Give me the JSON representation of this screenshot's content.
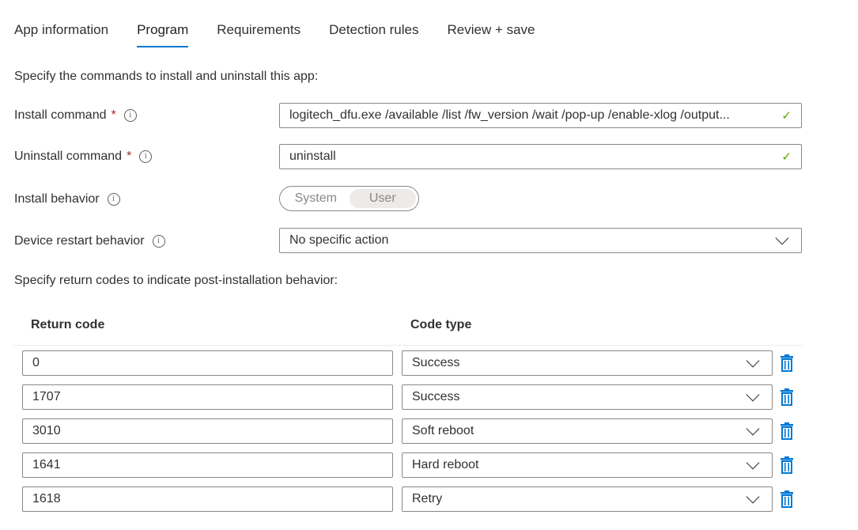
{
  "tabs": [
    {
      "label": "App information",
      "active": false
    },
    {
      "label": "Program",
      "active": true
    },
    {
      "label": "Requirements",
      "active": false
    },
    {
      "label": "Detection rules",
      "active": false
    },
    {
      "label": "Review + save",
      "active": false
    }
  ],
  "commands_intro": "Specify the commands to install and uninstall this app:",
  "install_command": {
    "label": "Install command",
    "required_mark": "*",
    "value": "logitech_dfu.exe /available /list /fw_version /wait /pop-up /enable-xlog /output..."
  },
  "uninstall_command": {
    "label": "Uninstall command",
    "required_mark": "*",
    "value": "uninstall"
  },
  "install_behavior": {
    "label": "Install behavior",
    "options": [
      "System",
      "User"
    ],
    "selected": "User"
  },
  "restart_behavior": {
    "label": "Device restart behavior",
    "value": "No specific action"
  },
  "return_codes_intro": "Specify return codes to indicate post-installation behavior:",
  "table": {
    "col_return_code": "Return code",
    "col_code_type": "Code type",
    "rows": [
      {
        "code": "0",
        "type": "Success"
      },
      {
        "code": "1707",
        "type": "Success"
      },
      {
        "code": "3010",
        "type": "Soft reboot"
      },
      {
        "code": "1641",
        "type": "Hard reboot"
      },
      {
        "code": "1618",
        "type": "Retry"
      }
    ]
  },
  "colors": {
    "accent": "#0078d4",
    "valid_check": "#57a300",
    "required": "#a4262c",
    "delete_icon": "#0078d4"
  },
  "icons": {
    "info": "info-icon",
    "check": "checkmark-icon",
    "dropdown": "chevron-down-icon",
    "delete": "trash-icon"
  }
}
